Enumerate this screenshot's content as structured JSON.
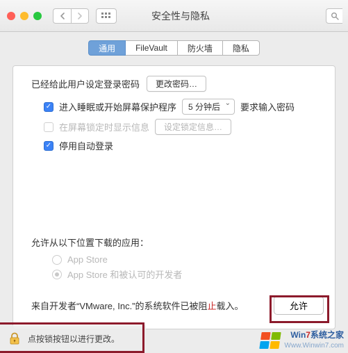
{
  "window": {
    "title": "安全性与隐私"
  },
  "tabs": [
    {
      "label": "通用",
      "active": true
    },
    {
      "label": "FileVault",
      "active": false
    },
    {
      "label": "防火墙",
      "active": false
    },
    {
      "label": "隐私",
      "active": false
    }
  ],
  "password_block": {
    "line": "已经给此用户设定登录密码",
    "change_btn": "更改密码…",
    "sleep_cb": "进入睡眠或开始屏幕保护程序",
    "sleep_cb_checked": true,
    "delay_select": "5 分钟后",
    "suffix": "要求输入密码",
    "lock_msg_cb": "在屏幕锁定时显示信息",
    "lock_msg_cb_checked": false,
    "set_lock_msg_btn": "设定锁定信息…",
    "auto_login_cb": "停用自动登录",
    "auto_login_cb_checked": true
  },
  "download_block": {
    "heading": "允许从以下位置下载的应用：",
    "opt1": "App Store",
    "opt2": "App Store 和被认可的开发者",
    "selected": 2
  },
  "blocked": {
    "prefix": "来自开发者“VMware, Inc.”的系统软件已被阻",
    "stop_word": "止",
    "suffix": "载入。",
    "allow_btn": "允许"
  },
  "lock_bar": {
    "text": "点按锁按钮以进行更改。"
  },
  "watermark": {
    "line1_a": "Win",
    "line1_b": "7",
    "line1_c": "系统之家",
    "line2": "Www.Winwin7.com"
  }
}
